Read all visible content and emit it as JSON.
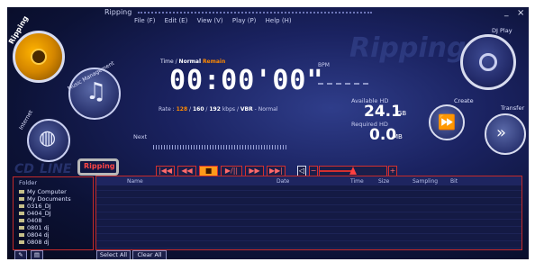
{
  "window": {
    "title": "Ripping",
    "minimize": "_",
    "close": "×"
  },
  "menu": [
    "File (F)",
    "Edit (E)",
    "View (V)",
    "Play (P)",
    "Help (H)"
  ],
  "background_words": {
    "cd": "CD",
    "line": "LINE",
    "ripping": "Ripping"
  },
  "circles": {
    "ripping": "Ripping",
    "music_management": "Music Management",
    "internet": "Internet",
    "dj_play": "DJ Play",
    "create": "Create",
    "transfer": "Transfer"
  },
  "time": {
    "normal": "Normal",
    "remain": "Remain",
    "prefix": "Time /",
    "digits": "00:00'00\""
  },
  "rate": {
    "label": "Rate :",
    "v1": "128",
    "v2": "160",
    "v3": "192",
    "unit": "kbps /",
    "vbr": "VBR",
    "suffix": "- Normal"
  },
  "bpm": {
    "label": "BPM"
  },
  "hd": {
    "available_label": "Available HD",
    "available_value": "24.1",
    "available_unit": "GB",
    "required_label": "Required HD",
    "required_value": "0.0",
    "required_unit": "MB"
  },
  "next_label": "Next",
  "transport": [
    "|◀◀",
    "◀◀",
    "■",
    "▶/||",
    "▶▶",
    "▶▶|"
  ],
  "volume": {
    "minus": "−",
    "plus": "+",
    "level": 0.5
  },
  "folder": {
    "header": "Folder",
    "items": [
      "My Computer",
      "My Documents",
      "0316_DJ",
      "0404_DJ",
      "0408",
      "0801 dj",
      "0804 dj",
      "0808 dj"
    ]
  },
  "table": {
    "columns": [
      "Name",
      "Date",
      "Time",
      "Size",
      "Sampling",
      "Bit"
    ],
    "rows": []
  },
  "buttons": {
    "select_all": "Select All",
    "clear_all": "Clear All"
  },
  "badge": "Ripping",
  "colors": {
    "accent": "#ff8a00",
    "border": "#c42a2a",
    "digits": "#ffffff"
  }
}
